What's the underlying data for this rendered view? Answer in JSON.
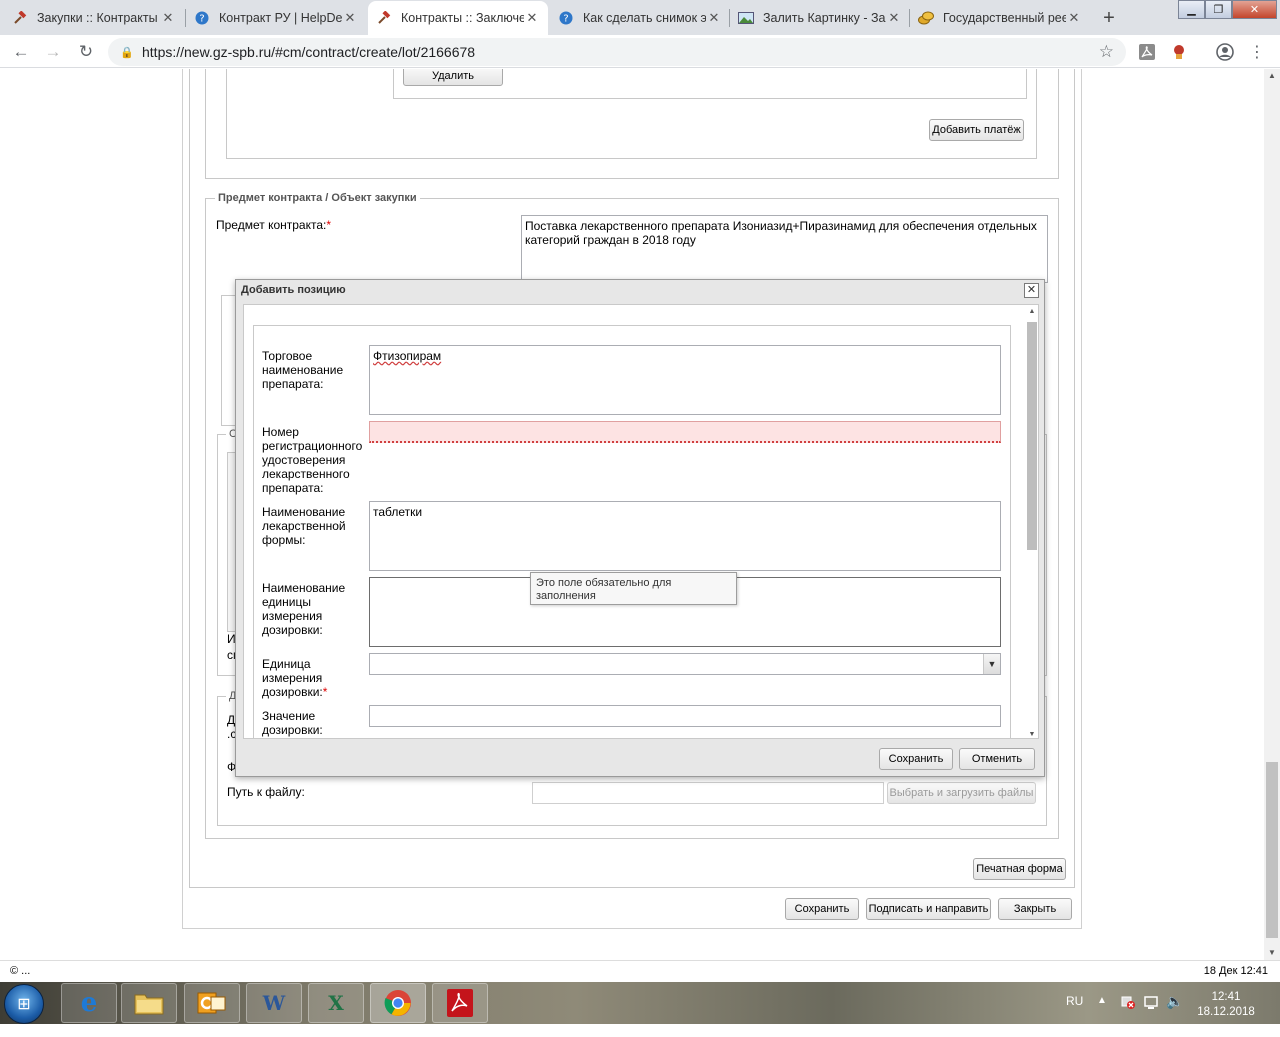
{
  "browser": {
    "tabs": [
      {
        "title": "Закупки :: Контракты",
        "icon": "hammer-icon",
        "active": false
      },
      {
        "title": "Контракт РУ | HelpDesk",
        "icon": "help-globe-icon",
        "active": false
      },
      {
        "title": "Контракты :: Заключение",
        "icon": "hammer-icon",
        "active": true
      },
      {
        "title": "Как сделать снимок экрана",
        "icon": "help-globe-icon",
        "active": false
      },
      {
        "title": "Залить Картинку - Загрузить",
        "icon": "picture-icon",
        "active": false
      },
      {
        "title": "Государственный реестр",
        "icon": "coins-icon",
        "active": false
      }
    ],
    "url": "https://new.gz-spb.ru/#cm/contract/create/lot/2166678"
  },
  "page": {
    "delete_button": "Удалить",
    "add_payment_button": "Добавить платёж",
    "subject_legend": "Предмет контракта / Объект закупки",
    "subject_label": "Предмет контракта:",
    "subject_value": "Поставка лекарственного препарата Изониазид+Пиразинамид для обеспечения отдельных категорий граждан в 2018 году",
    "required_mark": "*",
    "fragment_i": "И",
    "fragment_sp": "сп",
    "fragment_d": "Д",
    "fragment_d2": "Д",
    "fragment_dot_c": ".с",
    "fragment_f": "Ф",
    "fragment_c": "С",
    "file_path_label": "Путь к файлу:",
    "choose_upload_button": "Выбрать и загрузить файлы",
    "print_form_button": "Печатная форма",
    "save_button": "Сохранить",
    "sign_send_button": "Подписать и направить",
    "close_button": "Закрыть"
  },
  "modal": {
    "title": "Добавить позицию",
    "close_glyph": "✕",
    "fields": {
      "trade_name_label": "Торговое наименование препарата:",
      "trade_name_value": "Фтизопирам",
      "reg_number_label": "Номер регистрационного удостоверения лекарственного препарата:",
      "reg_number_value": "",
      "form_name_label": "Наименование лекарственной формы:",
      "form_name_value": "таблетки",
      "dose_unit_name_label": "Наименование единицы измерения дозировки:",
      "dose_unit_name_value": "",
      "dose_unit_label": "Единица измерения дозировки:",
      "dose_unit_value": "",
      "dose_value_label": "Значение дозировки:",
      "dose_value_value": ""
    },
    "tooltip": "Это поле обязательно для заполнения",
    "save_button": "Сохранить",
    "cancel_button": "Отменить"
  },
  "statusbar": {
    "left": "© ...",
    "right": "18 Дек 12:41"
  },
  "taskbar": {
    "apps": [
      "ie-icon",
      "explorer-icon",
      "outlook-icon",
      "word-icon",
      "excel-icon",
      "chrome-icon",
      "acrobat-icon"
    ],
    "language": "RU",
    "time": "12:41",
    "date": "18.12.2018"
  },
  "colors": {
    "required": "#dd0000",
    "invalid_field_bg": "#fde3e3",
    "invalid_field_border": "#e0a0a0"
  }
}
